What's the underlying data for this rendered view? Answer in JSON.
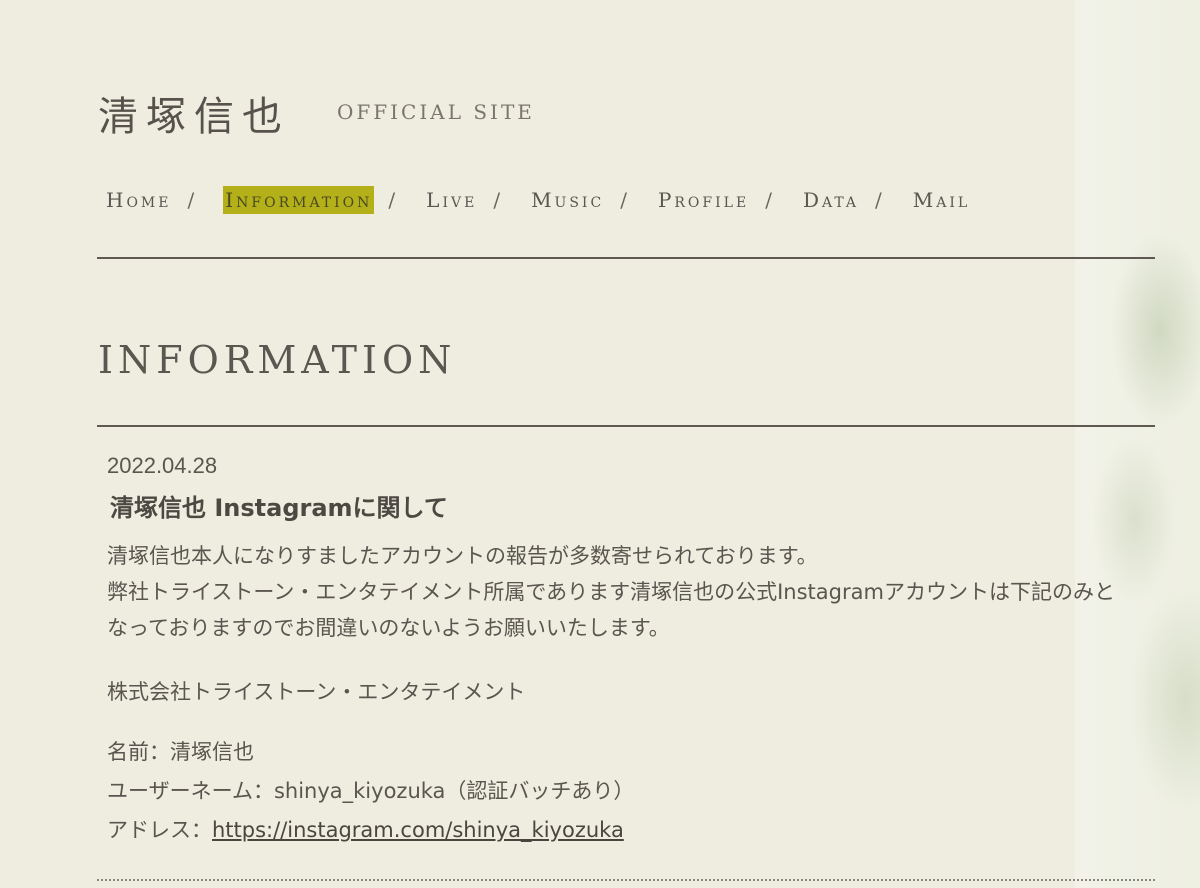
{
  "header": {
    "title": "清塚信也",
    "subtitle": "OFFICIAL SITE"
  },
  "nav": {
    "items": [
      {
        "label": "Home"
      },
      {
        "label": "Information"
      },
      {
        "label": "Live"
      },
      {
        "label": "Music"
      },
      {
        "label": "Profile"
      },
      {
        "label": "Data"
      },
      {
        "label": "Mail"
      }
    ],
    "separator": "/",
    "active_item": "Information",
    "active_color": "#b4b01a"
  },
  "section": {
    "title": "INFORMATION"
  },
  "post": {
    "date": "2022.04.28",
    "title": "清塚信也 Instagramに関して",
    "paragraph_1": "清塚信也本人になりすましたアカウントの報告が多数寄せられております。",
    "paragraph_2": "弊社トライストーン・エンタテイメント所属であります清塚信也の公式Instagramアカウントは下記のみとなっておりますのでお間違いのないようお願いいたします。",
    "company": "株式会社トライストーン・エンタテイメント",
    "name_label": "名前：",
    "name_value": "清塚信也",
    "username_label": "ユーザーネーム：",
    "username_value": "shinya_kiyozuka（認証バッチあり）",
    "address_label": "アドレス：",
    "address_link": "https://instagram.com/shinya_kiyozuka"
  }
}
